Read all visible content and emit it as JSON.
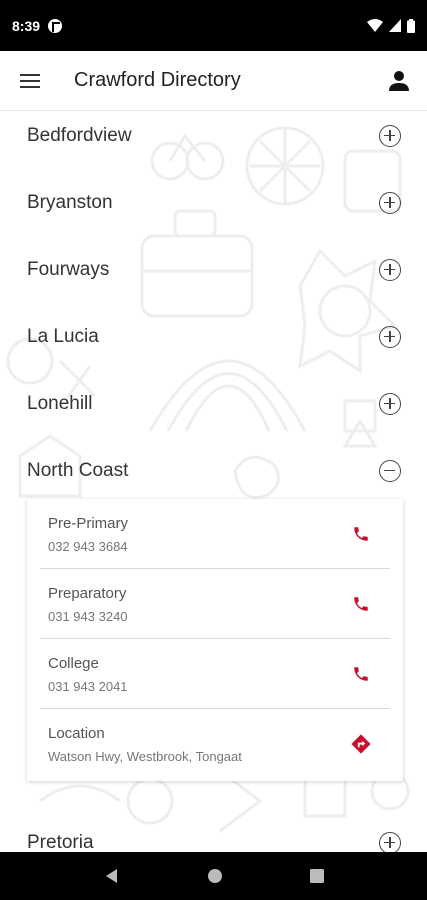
{
  "status": {
    "time": "8:39"
  },
  "app": {
    "title": "Crawford Directory"
  },
  "regions": [
    {
      "label": "Bedfordview",
      "expanded": false
    },
    {
      "label": "Bryanston",
      "expanded": false
    },
    {
      "label": "Fourways",
      "expanded": false
    },
    {
      "label": "La Lucia",
      "expanded": false
    },
    {
      "label": "Lonehill",
      "expanded": false
    },
    {
      "label": "North Coast",
      "expanded": true
    },
    {
      "label": "Pretoria",
      "expanded": false
    }
  ],
  "north_coast": {
    "entries": [
      {
        "name": "Pre-Primary",
        "detail": "032 943 3684",
        "action_icon": "phone-icon"
      },
      {
        "name": "Preparatory",
        "detail": "031 943 3240",
        "action_icon": "phone-icon"
      },
      {
        "name": "College",
        "detail": "031 943 2041",
        "action_icon": "phone-icon"
      },
      {
        "name": "Location",
        "detail": "Watson Hwy, Westbrook, Tongaat",
        "action_icon": "directions-icon"
      }
    ]
  },
  "colors": {
    "accent": "#c8102e",
    "statusbar": "#000000",
    "divider": "#e6e6e6"
  }
}
